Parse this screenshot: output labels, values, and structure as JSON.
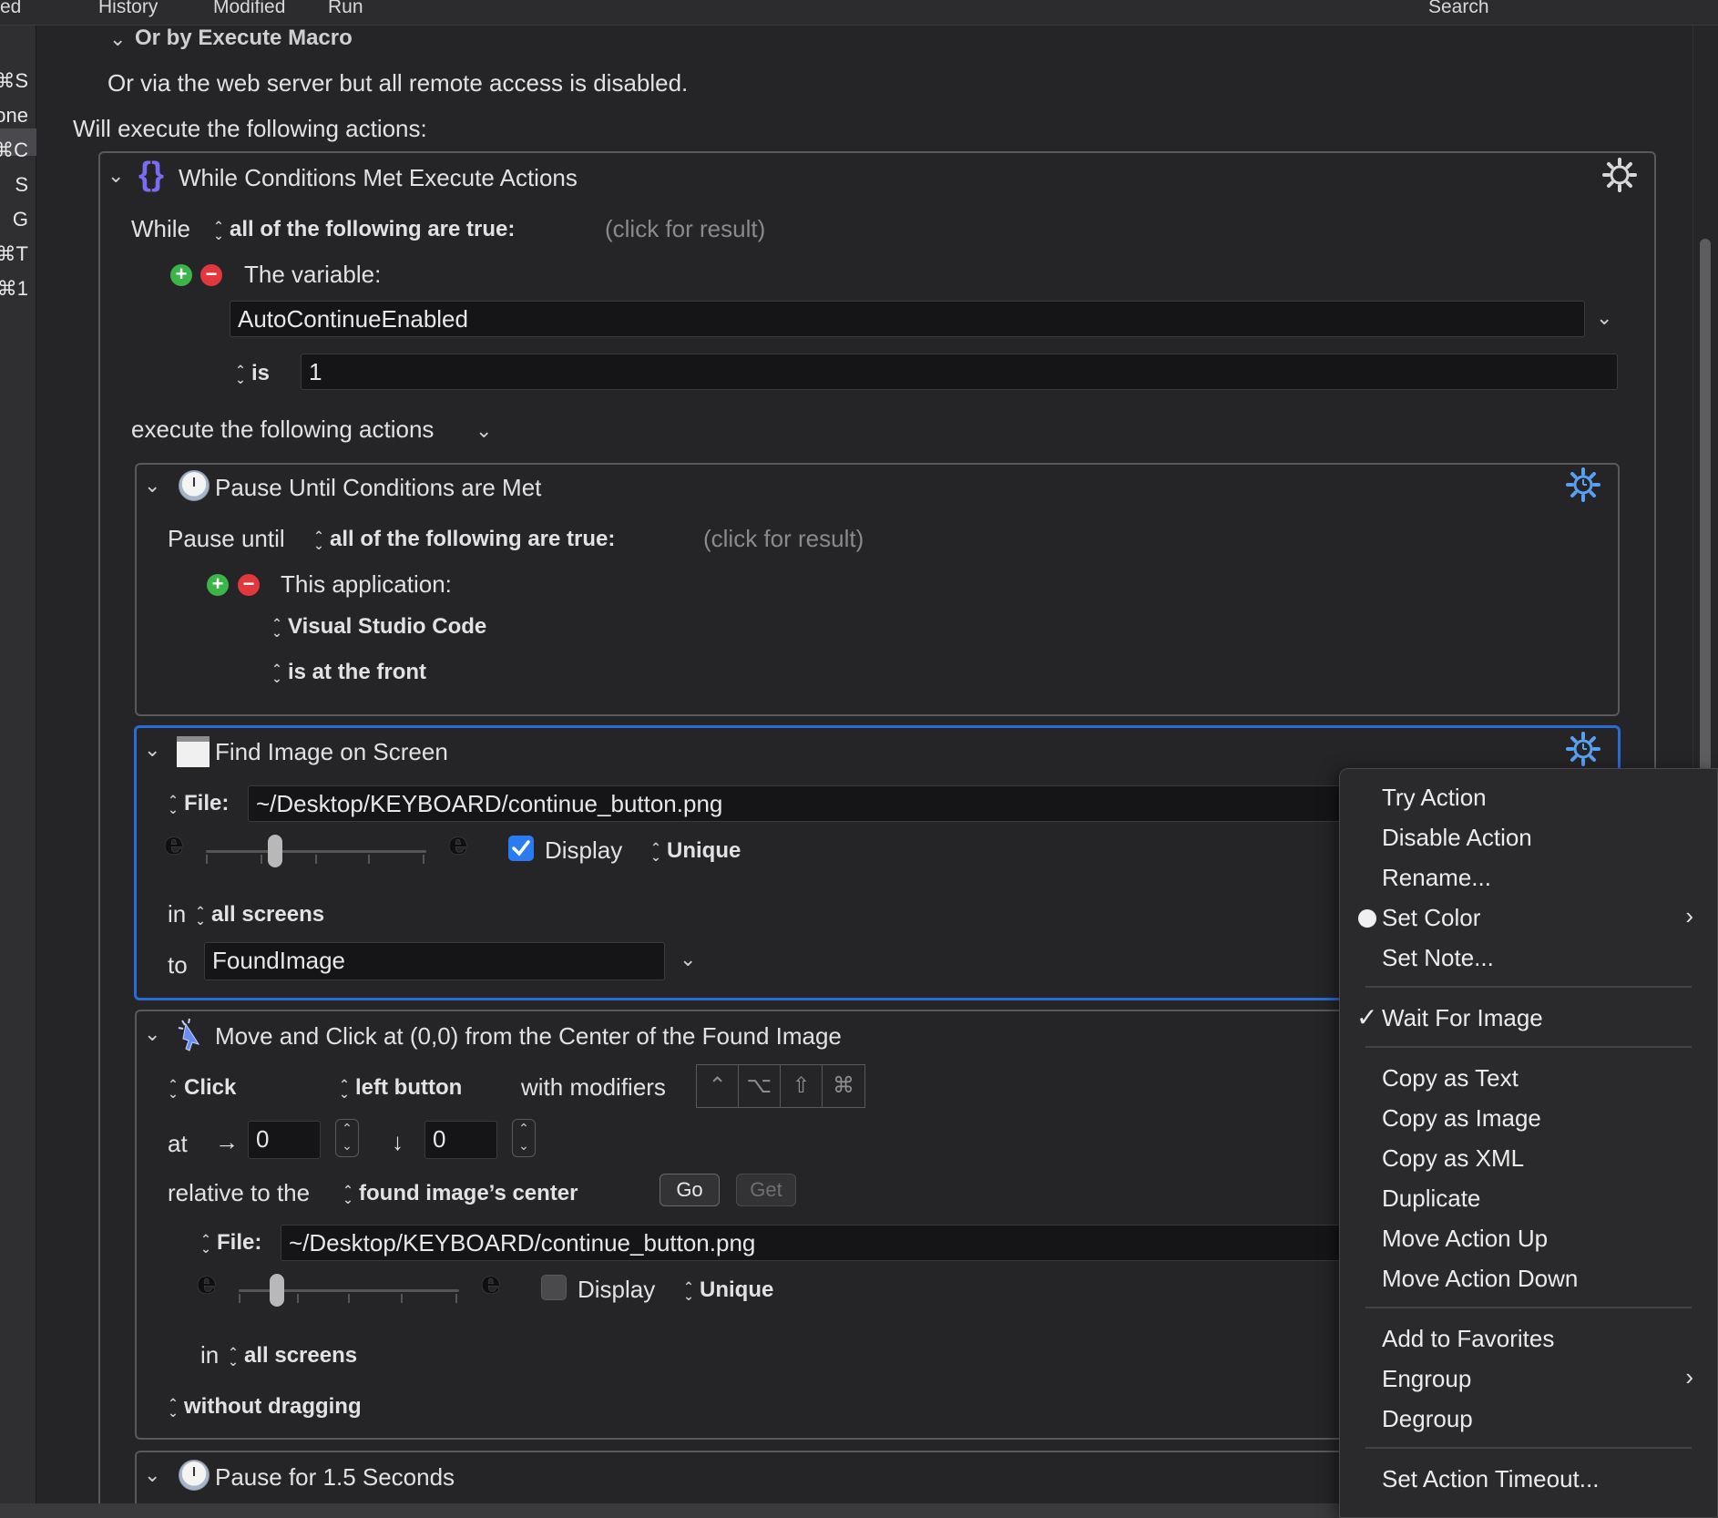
{
  "menubar": {
    "left_fragment": "ed",
    "history": "History",
    "modified": "Modified",
    "run": "Run",
    "search": "Search"
  },
  "sidebar_shortcuts": [
    "⌘S",
    "one",
    "⌘C",
    "S",
    "G",
    "⌘T",
    "⌘1"
  ],
  "trigger": {
    "execute_macro_header": "Or by Execute Macro",
    "web_server_note": "Or via the web server but all remote access is disabled.",
    "will_execute": "Will execute the following actions:"
  },
  "while_action": {
    "title": "While Conditions Met Execute Actions",
    "while_label": "While",
    "condition_mode": "all of the following are true:",
    "click_for_result": "(click for result)",
    "variable_label": "The variable:",
    "variable_name": "AutoContinueEnabled",
    "is_label": "is",
    "is_value": "1",
    "execute_label": "execute the following actions"
  },
  "pause_until_action": {
    "title": "Pause Until Conditions are Met",
    "pause_label": "Pause until",
    "condition_mode": "all of the following are true:",
    "click_for_result": "(click for result)",
    "app_label": "This application:",
    "app_name": "Visual Studio Code",
    "app_state": "is at the front"
  },
  "find_image_action": {
    "title": "Find Image on Screen",
    "file_label": "File:",
    "file_path": "~/Desktop/KEYBOARD/continue_button.png",
    "display_label": "Display",
    "display_checked": true,
    "unique_label": "Unique",
    "in_label": "in",
    "screens_value": "all screens",
    "to_label": "to",
    "variable_value": "FoundImage"
  },
  "move_click_action": {
    "title": "Move and Click at (0,0) from the Center of the Found Image",
    "click_value": "Click",
    "button_value": "left button",
    "modifiers_label": "with modifiers",
    "modifier_keys": [
      "⌃",
      "⌥",
      "⇧",
      "⌘"
    ],
    "at_label": "at",
    "x_value": "0",
    "y_value": "0",
    "relative_label": "relative to the",
    "relative_value": "found image’s center",
    "go_label": "Go",
    "get_label": "Get",
    "file_label": "File:",
    "file_path": "~/Desktop/KEYBOARD/continue_button.png",
    "display_label": "Display",
    "display_checked": false,
    "unique_label": "Unique",
    "in_label": "in",
    "screens_value": "all screens",
    "drag_value": "without dragging"
  },
  "pause_action": {
    "title": "Pause for 1.5 Seconds"
  },
  "context_menu": {
    "try_action": "Try Action",
    "disable_action": "Disable Action",
    "rename": "Rename...",
    "set_color": "Set Color",
    "set_note": "Set Note...",
    "wait_for_image": "Wait For Image",
    "wait_for_image_checked": true,
    "copy_as_text": "Copy as Text",
    "copy_as_image": "Copy as Image",
    "copy_as_xml": "Copy as XML",
    "duplicate": "Duplicate",
    "move_up": "Move Action Up",
    "move_down": "Move Action Down",
    "add_favorites": "Add to Favorites",
    "engroup": "Engroup",
    "degroup": "Degroup",
    "set_timeout": "Set Action Timeout..."
  },
  "colors": {
    "accent": "#2a6cd6",
    "add": "#3bb54a",
    "remove": "#e0383e",
    "checkbox": "#2a7bf2"
  }
}
